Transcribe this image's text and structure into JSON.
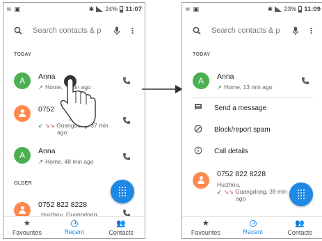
{
  "left": {
    "status": {
      "battery": "24%",
      "time": "11:07"
    },
    "search_placeholder": "Search contacts & p",
    "section_today": "TODAY",
    "section_older": "OLDER",
    "calls": [
      {
        "initial": "A",
        "name": "Anna",
        "detail": "Home, 13 min ago",
        "detail_shown": "Home, ",
        "detail_tail": "min ago"
      },
      {
        "name": "0752 822 8228",
        "name_shown": "0752",
        "name_tail": "228",
        "detail": "Huizhou, Guangdong, 37 min ago",
        "line1": "zhou,",
        "line2": "Guangdong, 37 min",
        "line3": "ago"
      },
      {
        "initial": "A",
        "name": "Anna",
        "detail": "Home, 48 min ago"
      },
      {
        "name": "0752 822 8228",
        "detail": "Huizhou, Guangdong,"
      }
    ]
  },
  "right": {
    "status": {
      "battery": "23%",
      "time": "11:09"
    },
    "search_placeholder": "Search contacts & p",
    "section_today": "TODAY",
    "expanded": {
      "initial": "A",
      "name": "Anna",
      "detail": "Home, 13 min ago"
    },
    "actions": [
      {
        "label": "Send a message",
        "icon": "message-icon"
      },
      {
        "label": "Block/report spam",
        "icon": "block-icon"
      },
      {
        "label": "Call details",
        "icon": "info-icon"
      }
    ],
    "second": {
      "name": "0752 822 8228",
      "line1": "Huizhou,",
      "line2": "Guangdong, 39 min",
      "line3": "ago"
    }
  },
  "nav": {
    "favourites": "Favourites",
    "recent": "Recent",
    "contacts": "Contacts"
  },
  "colors": {
    "accent": "#1e88e5",
    "green_avatar": "#4caf50",
    "orange_avatar": "#ff8a50"
  }
}
